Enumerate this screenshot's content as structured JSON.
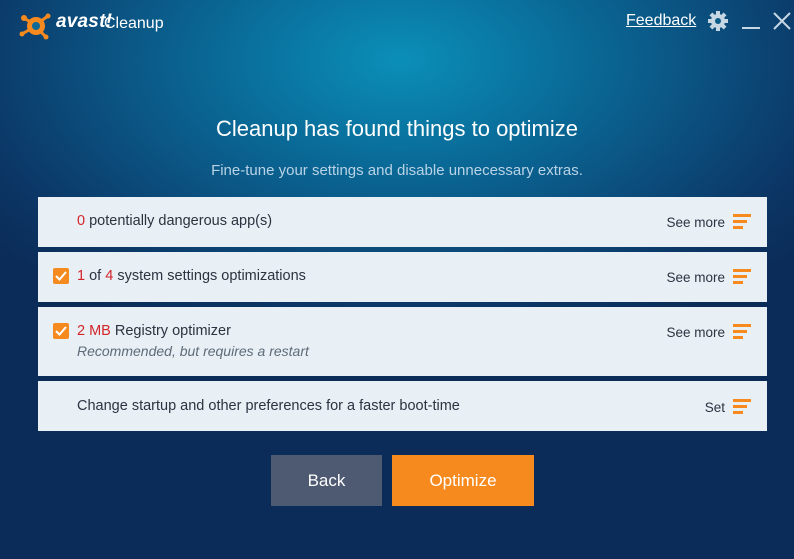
{
  "header": {
    "brand": "avast!",
    "app_name": "Cleanup",
    "feedback_label": "Feedback"
  },
  "title": "Cleanup has found things to optimize",
  "subtitle": "Fine-tune your settings and disable unnecessary extras.",
  "rows": [
    {
      "count": "0",
      "text": " potentially dangerous app(s)",
      "action": "See more",
      "checked": false
    },
    {
      "count": "1",
      "mid": " of ",
      "total": "4",
      "text": " system settings optimizations",
      "action": "See more",
      "checked": true
    },
    {
      "count": "2 MB",
      "text": " Registry optimizer",
      "note": "Recommended, but requires a restart",
      "action": "See more",
      "checked": true
    },
    {
      "text": "Change startup and other preferences for a faster boot-time",
      "action": "Set",
      "checked": false
    }
  ],
  "buttons": {
    "back": "Back",
    "optimize": "Optimize"
  },
  "colors": {
    "accent": "#f68a1e",
    "highlight": "#d2262b",
    "row_bg": "#e8eff5",
    "back_button": "#4e5a72"
  },
  "icons": [
    "avast-logo-icon",
    "gear-icon",
    "minimize-icon",
    "close-icon",
    "checkbox-checked-icon",
    "details-lines-icon"
  ]
}
